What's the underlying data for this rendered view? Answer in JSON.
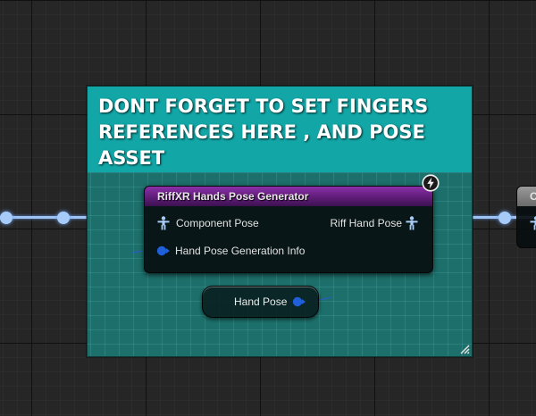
{
  "comment": {
    "text": "DONT FORGET TO SET FINGERS REFERENCES HERE , AND POSE ASSET",
    "color": "#12a6a6"
  },
  "function_node": {
    "title": "RiffXR Hands Pose Generator",
    "header_color": "#6e2290",
    "latent_icon": "clock-icon",
    "input_pins": [
      {
        "label": "Component Pose",
        "type": "pose",
        "icon": "pose-figure-icon"
      },
      {
        "label": "Hand Pose Generation Info",
        "type": "object",
        "icon": "object-pin-icon"
      }
    ],
    "output_pins": [
      {
        "label": "Riff Hand Pose",
        "type": "pose",
        "icon": "pose-figure-icon"
      }
    ]
  },
  "variable_node": {
    "label": "Hand Pose",
    "pin_color": "#1a57c8"
  },
  "offscreen_node": {
    "title": "C"
  },
  "colors": {
    "pose_wire": "#9fc4f4",
    "object_pin": "#1f5fd8",
    "background": "#262626"
  }
}
